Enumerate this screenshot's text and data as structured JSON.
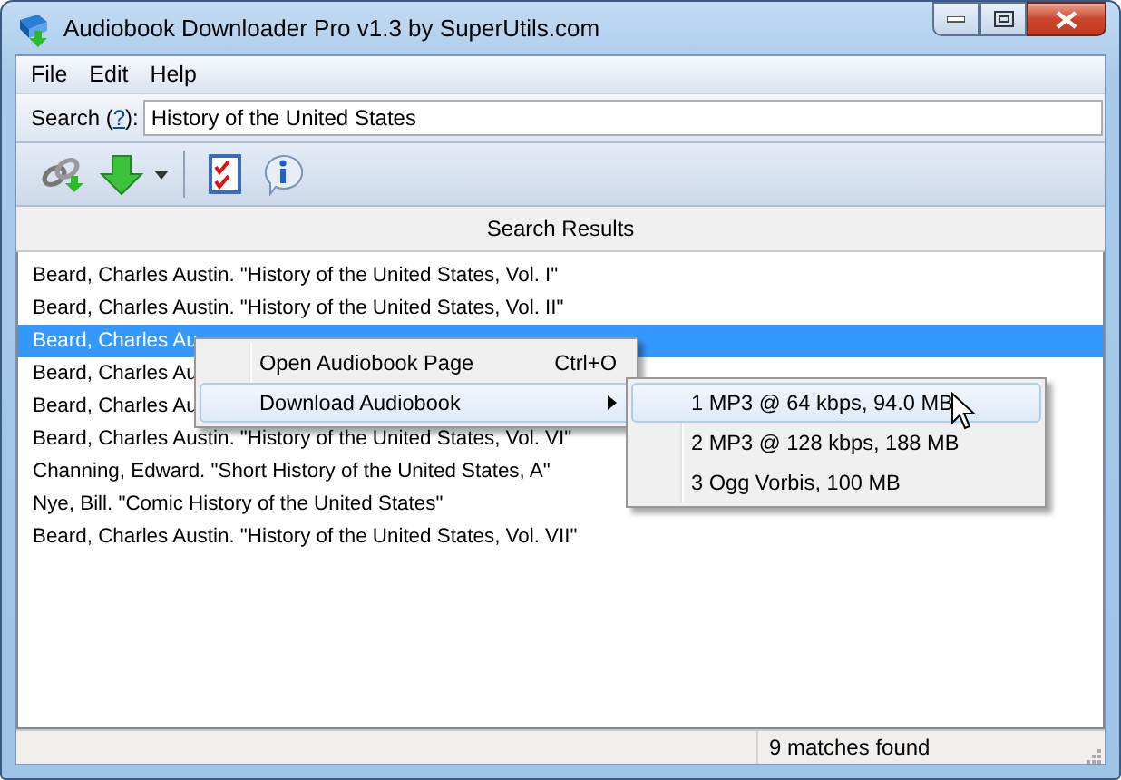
{
  "window": {
    "title": "Audiobook Downloader Pro v1.3 by SuperUtils.com"
  },
  "menu_bar": [
    "File",
    "Edit",
    "Help"
  ],
  "search": {
    "label": "Search (",
    "help_link": "?",
    "label_end": "):",
    "value": "History of the United States"
  },
  "results": {
    "header": "Search Results",
    "rows": [
      {
        "text": "Beard, Charles Austin. \"History of the United States, Vol. I\"",
        "selected": false
      },
      {
        "text": "Beard, Charles Austin. \"History of the United States, Vol. II\"",
        "selected": false
      },
      {
        "text": "Beard, Charles Au",
        "selected": true
      },
      {
        "text": "Beard, Charles Au",
        "selected": false
      },
      {
        "text": "Beard, Charles Au",
        "selected": false
      },
      {
        "text": "Beard, Charles Austin. \"History of the United States, Vol. VI\"",
        "selected": false
      },
      {
        "text": "Channing, Edward. \"Short History of the United States, A\"",
        "selected": false
      },
      {
        "text": "Nye, Bill. \"Comic History of the United States\"",
        "selected": false
      },
      {
        "text": "Beard, Charles Austin. \"History of the United States, Vol. VII\"",
        "selected": false
      }
    ]
  },
  "context_menu": {
    "items": [
      {
        "label": "Open Audiobook Page",
        "shortcut": "Ctrl+O",
        "has_submenu": false,
        "highlighted": false
      },
      {
        "label": "Download Audiobook",
        "has_submenu": true,
        "highlighted": true
      }
    ]
  },
  "submenu": {
    "items": [
      {
        "label": "1 MP3 @ 64 kbps, 94.0 MB",
        "highlighted": true
      },
      {
        "label": "2 MP3 @ 128 kbps, 188 MB",
        "highlighted": false
      },
      {
        "label": "3 Ogg Vorbis, 100 MB",
        "highlighted": false
      }
    ]
  },
  "status_bar": {
    "text": "9 matches found"
  }
}
